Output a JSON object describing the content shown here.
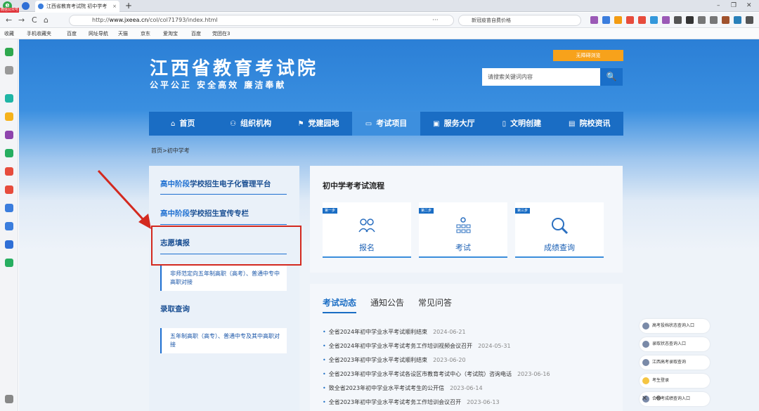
{
  "browser": {
    "tab_title": "江西省教育考试院 初中学考",
    "tab_close": "×",
    "new_tab": "+",
    "logo_badge": "微信公众号",
    "url_prefix": "http://",
    "url_host": "www.jxeea.cn",
    "url_path": "/col/col71793/index.html",
    "search_placeholder": "新冠疫苗自费价格",
    "nav_back": "←",
    "nav_forward": "→",
    "nav_refresh": "C",
    "nav_home": "⌂",
    "menu_dots": "···",
    "window_min": "–",
    "window_max": "❐",
    "window_close": "✕"
  },
  "bookmarks": [
    {
      "label": "收藏"
    },
    {
      "label": "手机收藏夹"
    },
    {
      "label": "百度"
    },
    {
      "label": "网址导航"
    },
    {
      "label": "天猫"
    },
    {
      "label": "京东"
    },
    {
      "label": "爱淘宝"
    },
    {
      "label": "百度"
    },
    {
      "label": "党团在3"
    }
  ],
  "site": {
    "title": "江西省教育考试院",
    "slogan": "公平公正 安全高效 廉洁奉献",
    "barrier_free": "无障碍浏览",
    "search_placeholder": "请搜索关键词内容",
    "search_icon": "🔍"
  },
  "nav": [
    {
      "icon": "⌂",
      "label": "首页",
      "active": false
    },
    {
      "icon": "⚇",
      "label": "组织机构",
      "active": false
    },
    {
      "icon": "⚑",
      "label": "党建园地",
      "active": false
    },
    {
      "icon": "▭",
      "label": "考试项目",
      "active": true
    },
    {
      "icon": "▣",
      "label": "服务大厅",
      "active": false
    },
    {
      "icon": "▯",
      "label": "文明创建",
      "active": false
    },
    {
      "icon": "▤",
      "label": "院校资讯",
      "active": false
    }
  ],
  "breadcrumb": "首页>初中学考",
  "left": {
    "link1_em": "高中阶段",
    "link1_rest": "学校招生电子化管理平台",
    "link2_em": "高中阶段",
    "link2_rest": "学校招生宣传专栏",
    "link3": "志愿填报",
    "sub3": "非师范定向五年制高职（高考）、普通中专中高职对接",
    "link4": "录取查询",
    "sub4": "五年制高职（高专）、普通中专及其中高职对接"
  },
  "process": {
    "title": "初中学考考试流程",
    "cards": [
      {
        "step": "第一步",
        "label": "报名"
      },
      {
        "step": "第二步",
        "label": "考试"
      },
      {
        "step": "第三步",
        "label": "成绩查询"
      }
    ]
  },
  "news": {
    "tabs": [
      {
        "label": "考试动态",
        "active": true
      },
      {
        "label": "通知公告",
        "active": false
      },
      {
        "label": "常见问答",
        "active": false
      }
    ],
    "items": [
      {
        "title": "全省2024年初中学业水平考试顺利结束",
        "date": "2024-06-21"
      },
      {
        "title": "全省2024年初中学业水平考试考务工作培训视频会议召开",
        "date": "2024-05-31"
      },
      {
        "title": "全省2023年初中学业水平考试顺利结束",
        "date": "2023-06-20"
      },
      {
        "title": "全省2023年初中学业水平考试各设区市教育考试中心（考试院）咨询电话",
        "date": "2023-06-16"
      },
      {
        "title": "致全省2023年初中学业水平考试考生的公开信",
        "date": "2023-06-14"
      },
      {
        "title": "全省2023年初中学业水平考试考务工作培训会议召开",
        "date": "2023-06-13"
      }
    ]
  },
  "float_links": [
    {
      "label": "高考投档状态查询入口"
    },
    {
      "label": "录取状态查询入口"
    },
    {
      "label": "江西高考录取查询"
    },
    {
      "label": "考生登录"
    },
    {
      "label": "合格考成绩查询入口"
    }
  ],
  "float_close": "✕",
  "float_settings": "⚙",
  "colors": {
    "primary": "#1a6dc4",
    "highlight_box": "#d3291f",
    "barrier_btn": "#f7a21b"
  }
}
